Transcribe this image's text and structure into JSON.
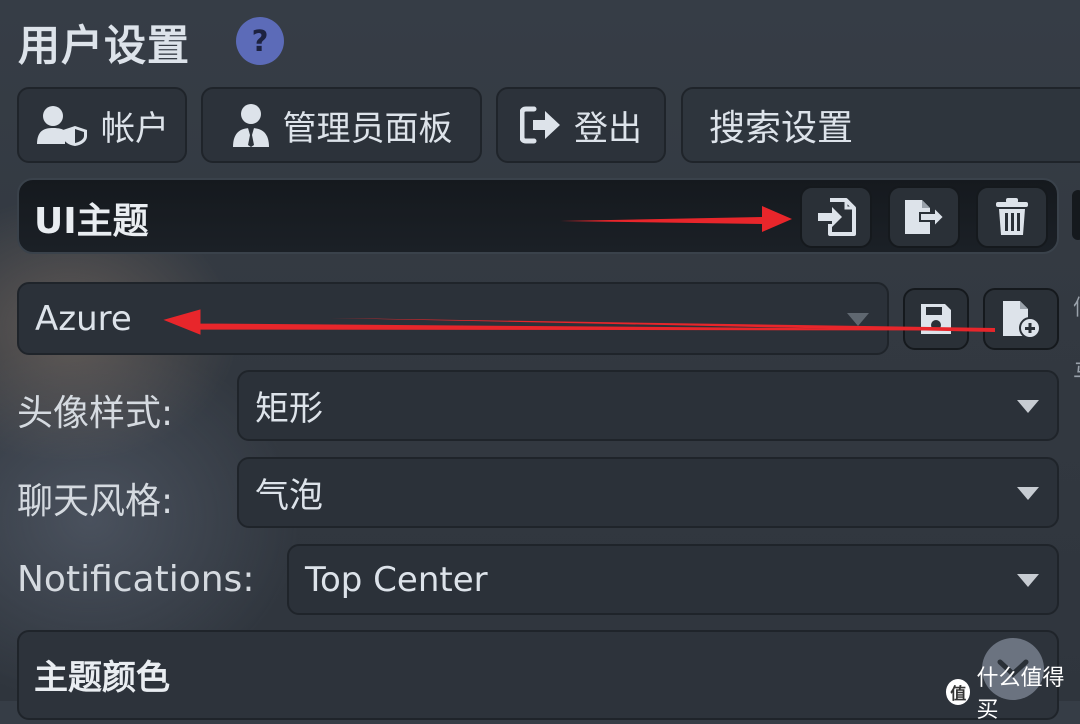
{
  "title": "用户设置",
  "help_icon": "?",
  "nav": {
    "account_label": "帐户",
    "admin_label": "管理员面板",
    "logout_label": "登出"
  },
  "search": {
    "placeholder": "搜索设置"
  },
  "ui_theme": {
    "heading": "UI主题",
    "theme_value": "Azure",
    "icons": [
      "import-icon",
      "export-icon",
      "trash-icon",
      "save-icon",
      "file-add-icon"
    ]
  },
  "avatar_style": {
    "label": "头像样式:",
    "value": "矩形"
  },
  "chat_style": {
    "label": "聊天风格:",
    "value": "气泡"
  },
  "notifications": {
    "label": "Notifications:",
    "value": "Top Center"
  },
  "theme_color": {
    "heading": "主题颜色"
  },
  "watermark": {
    "text": "什么值得买",
    "logo": "值"
  },
  "right_edge_chars": [
    "偃",
    "马"
  ],
  "colors": {
    "accent": "#5c6bb8",
    "annotation_arrow": "#e8262b",
    "panel": "#2c323a",
    "background": "#343a42"
  }
}
